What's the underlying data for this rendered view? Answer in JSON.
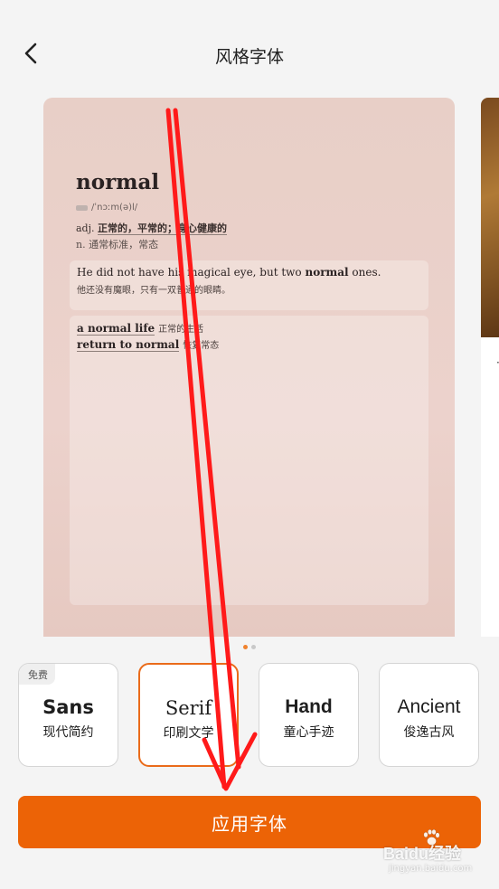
{
  "header": {
    "title": "风格字体",
    "back_icon": "chevron-left-icon"
  },
  "preview": {
    "word": "normal",
    "phonetic": "/ˈnɔːm(ə)l/",
    "definition_adj_prefix": "adj.",
    "definition_adj_bold": "正常的，平常的；身心健康的",
    "definition_n": "n. 通常标准，常态",
    "example_en_before": "He did not have his magical eye, but two ",
    "example_en_bold": "normal",
    "example_en_after": " ones.",
    "example_cn": "他还没有魔眼，只有一双普通的眼睛。",
    "phrases": [
      {
        "en": "a normal life",
        "cn": "正常的生活"
      },
      {
        "en": "return to normal",
        "cn": "恢复常态"
      }
    ]
  },
  "pager": {
    "count": 2,
    "active": 0
  },
  "font_options": [
    {
      "en": "Sans",
      "cn": "现代简约",
      "badge": "免费",
      "selected": false
    },
    {
      "en": "Serif",
      "cn": "印刷文学",
      "selected": true
    },
    {
      "en": "Hand",
      "cn": "童心手迹",
      "selected": false
    },
    {
      "en": "Ancient",
      "cn": "俊逸古风",
      "selected": false
    }
  ],
  "apply_button": {
    "label": "应用字体"
  },
  "watermark": {
    "main": "Baidu经验",
    "sub": "jingyan.baidu.com"
  },
  "colors": {
    "accent": "#ec6306",
    "selected_border": "#ea6b1a",
    "arrow": "#ff1a1a",
    "card_bg": "#e8cfc7"
  }
}
